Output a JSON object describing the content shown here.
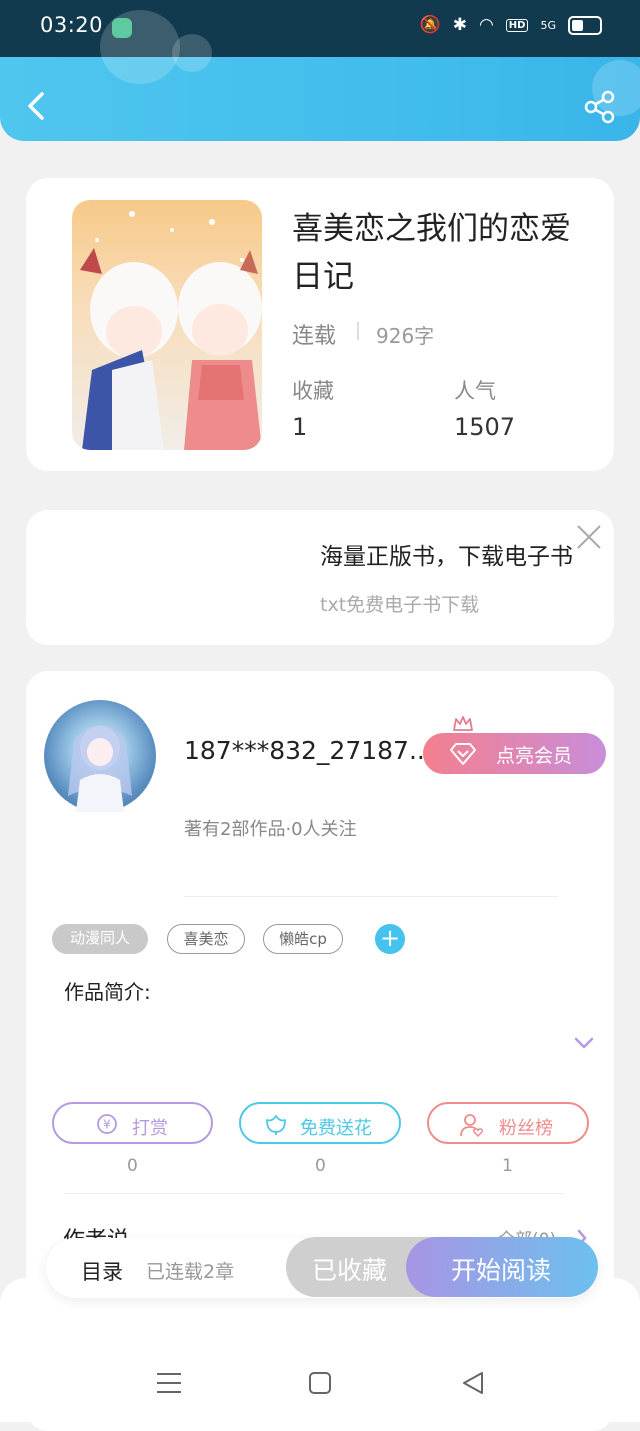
{
  "status_bar": {
    "time": "03:20",
    "hd": "HD",
    "signal": "5G"
  },
  "book": {
    "title": "喜美恋之我们的恋爱日记",
    "status": "连载",
    "word_count": "926字",
    "stats": [
      {
        "label": "收藏",
        "value": "1"
      },
      {
        "label": "人气",
        "value": "1507"
      }
    ]
  },
  "ad": {
    "title": "海量正版书，下载电子书",
    "subtitle": "txt免费电子书下载"
  },
  "author": {
    "name": "187***832_27187...",
    "vip_label": "点亮会员",
    "meta": "著有2部作品·0人关注"
  },
  "tags": [
    "动漫同人",
    "喜美恋",
    "懒皓cp"
  ],
  "intro_label": "作品简介:",
  "actions": [
    {
      "label": "打赏",
      "count": "0",
      "color": "#b49be0"
    },
    {
      "label": "免费送花",
      "count": "0",
      "color": "#4cc9e6"
    },
    {
      "label": "粉丝榜",
      "count": "1",
      "color": "#ef8c8c"
    }
  ],
  "author_says": {
    "label": "作者说",
    "all": "全部(0)"
  },
  "bottom": {
    "toc": "目录",
    "chapters": "已连载2章",
    "saved": "已收藏",
    "read": "开始阅读"
  }
}
